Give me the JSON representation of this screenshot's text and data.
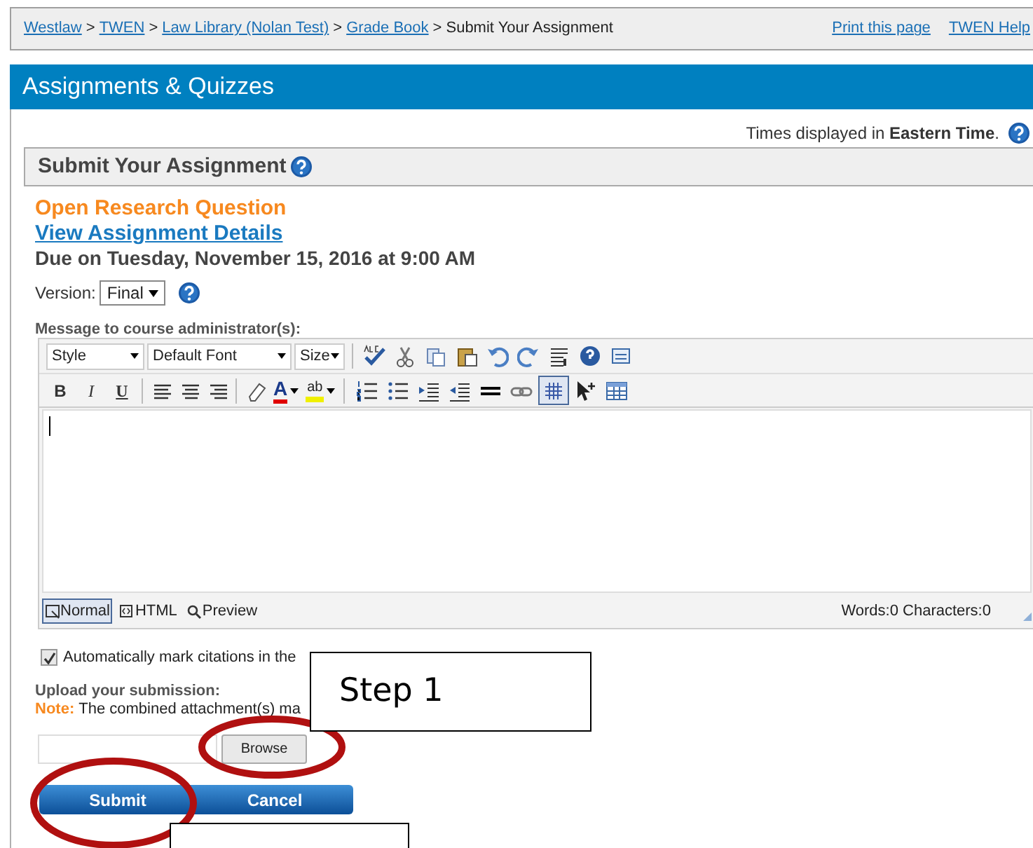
{
  "breadcrumb": [
    {
      "label": "Westlaw",
      "link": true
    },
    {
      "label": "TWEN",
      "link": true
    },
    {
      "label": "Law Library (Nolan Test)",
      "link": true
    },
    {
      "label": "Grade Book",
      "link": true
    },
    {
      "label": "Submit Your Assignment",
      "link": false
    }
  ],
  "breadcrumb_separator": ">",
  "top_links": [
    "Print this page",
    "TWEN Help"
  ],
  "header": {
    "title": "Assignments & Quizzes"
  },
  "timezone_note": "Times displayed in **Eastern Time**.",
  "section_title": "Submit Your Assignment",
  "assignment": {
    "name": "Open Research Question",
    "details_link": "View Assignment Details",
    "due": "Due on Tuesday, November 15, 2016 at 9:00 AM"
  },
  "version": {
    "label": "Version:",
    "value": "Final"
  },
  "message_label": "Message to course administrator(s):",
  "editor": {
    "dropdowns": [
      "Style",
      "Default Font",
      "Size"
    ],
    "format_buttons": [
      "B",
      "I",
      "U"
    ],
    "font_color_label": "A",
    "highlight_label": "ab",
    "grid_toggle_selected": true,
    "modes": [
      {
        "label": "Normal",
        "selected": true
      },
      {
        "label": "HTML",
        "selected": false
      },
      {
        "label": "Preview",
        "selected": false
      }
    ],
    "counts": "Words:0 Characters:0"
  },
  "auto_mark": {
    "label": "Automatically mark citations in the",
    "checked": true
  },
  "upload": {
    "label": "Upload your submission:",
    "note_label": "Note:",
    "note": "The combined attachment(s) ma",
    "browse": "Browse"
  },
  "buttons": [
    "Submit",
    "Cancel"
  ],
  "callouts": [
    {
      "text": "Step 1"
    }
  ]
}
